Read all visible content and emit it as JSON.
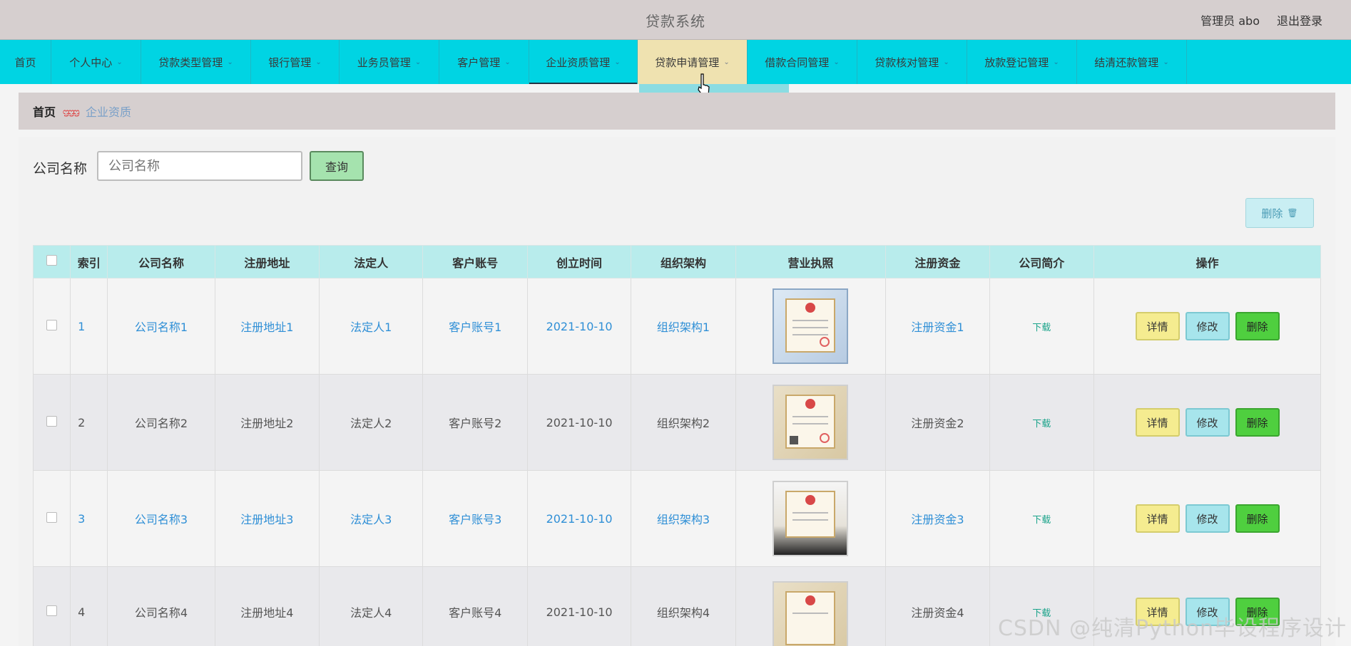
{
  "header": {
    "title": "贷款系统",
    "user": "管理员 abo",
    "logout": "退出登录"
  },
  "nav": [
    {
      "label": "首页",
      "chev": ""
    },
    {
      "label": "个人中心",
      "chev": "⌄"
    },
    {
      "label": "贷款类型管理",
      "chev": "⌄"
    },
    {
      "label": "银行管理",
      "chev": "⌄"
    },
    {
      "label": "业务员管理",
      "chev": "⌄"
    },
    {
      "label": "客户管理",
      "chev": "⌄"
    },
    {
      "label": "企业资质管理",
      "chev": "⌄"
    },
    {
      "label": "贷款申请管理",
      "chev": "⌄"
    },
    {
      "label": "借款合同管理",
      "chev": "⌄"
    },
    {
      "label": "贷款核对管理",
      "chev": "⌄"
    },
    {
      "label": "放款登记管理",
      "chev": "⌄"
    },
    {
      "label": "结清还款管理",
      "chev": "⌄"
    }
  ],
  "breadcrumb": {
    "home": "首页",
    "sep": "ᦗᦗᦗ",
    "current": "企业资质"
  },
  "search": {
    "label": "公司名称",
    "placeholder": "公司名称",
    "button": "查询"
  },
  "toolbar": {
    "delete_label": "删除",
    "delete_icon": "🗑"
  },
  "table": {
    "headers": [
      "",
      "索引",
      "公司名称",
      "注册地址",
      "法定人",
      "客户账号",
      "创立时间",
      "组织架构",
      "营业执照",
      "注册资金",
      "公司简介",
      "操作"
    ],
    "rows": [
      {
        "index": "1",
        "name": "公司名称1",
        "address": "注册地址1",
        "legal": "法定人1",
        "account": "客户账号1",
        "date": "2021-10-10",
        "org": "组织架构1",
        "capital": "注册资金1",
        "intro": "下载"
      },
      {
        "index": "2",
        "name": "公司名称2",
        "address": "注册地址2",
        "legal": "法定人2",
        "account": "客户账号2",
        "date": "2021-10-10",
        "org": "组织架构2",
        "capital": "注册资金2",
        "intro": "下载"
      },
      {
        "index": "3",
        "name": "公司名称3",
        "address": "注册地址3",
        "legal": "法定人3",
        "account": "客户账号3",
        "date": "2021-10-10",
        "org": "组织架构3",
        "capital": "注册资金3",
        "intro": "下载"
      },
      {
        "index": "4",
        "name": "公司名称4",
        "address": "注册地址4",
        "legal": "法定人4",
        "account": "客户账号4",
        "date": "2021-10-10",
        "org": "组织架构4",
        "capital": "注册资金4",
        "intro": "下载"
      }
    ],
    "actions": {
      "detail": "详情",
      "edit": "修改",
      "delete": "删除"
    }
  },
  "watermark": "CSDN @纯清Python毕设程序设计"
}
